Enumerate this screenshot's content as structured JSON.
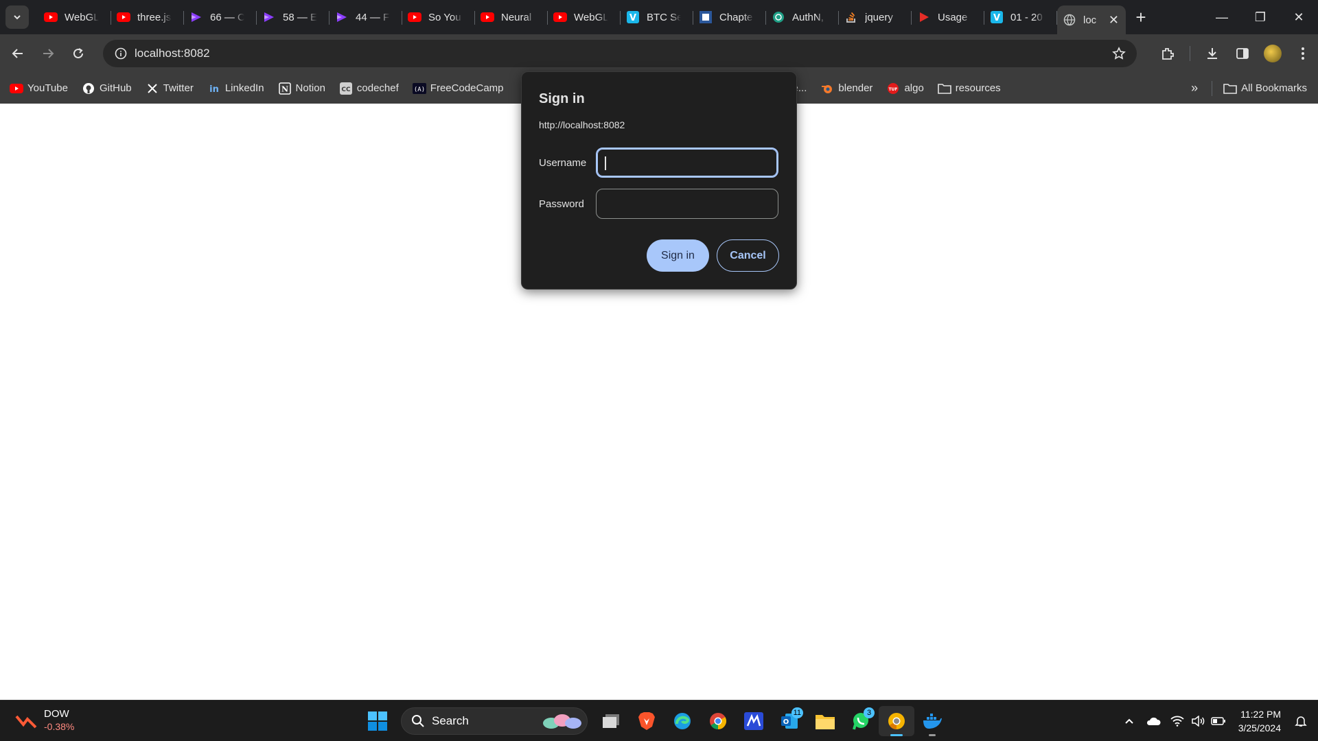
{
  "tabs": [
    {
      "title": "WebGL",
      "icon": "youtube-icon"
    },
    {
      "title": "three.js",
      "icon": "youtube-icon"
    },
    {
      "title": "66 — C",
      "icon": "course-icon"
    },
    {
      "title": "58 — E",
      "icon": "course-icon"
    },
    {
      "title": "44 — F",
      "icon": "course-icon"
    },
    {
      "title": "So You",
      "icon": "youtube-icon"
    },
    {
      "title": "Neural",
      "icon": "youtube-icon"
    },
    {
      "title": "WebGL",
      "icon": "youtube-icon"
    },
    {
      "title": "BTC Se",
      "icon": "vimeo-icon"
    },
    {
      "title": "Chapte",
      "icon": "document-icon"
    },
    {
      "title": "AuthN,",
      "icon": "openai-icon"
    },
    {
      "title": "jquery",
      "icon": "stackoverflow-icon"
    },
    {
      "title": "Usage",
      "icon": "play-icon"
    },
    {
      "title": "01 - 20",
      "icon": "vimeo-icon"
    }
  ],
  "active_tab": {
    "title": "loc",
    "icon": "globe-icon"
  },
  "address_bar": {
    "url": "localhost:8082"
  },
  "bookmarks": [
    {
      "label": "YouTube",
      "icon": "youtube-icon"
    },
    {
      "label": "GitHub",
      "icon": "github-icon"
    },
    {
      "label": "Twitter",
      "icon": "x-icon"
    },
    {
      "label": "LinkedIn",
      "icon": "linkedin-icon"
    },
    {
      "label": "Notion",
      "icon": "notion-icon"
    },
    {
      "label": "codechef",
      "icon": "codechef-icon"
    },
    {
      "label": "FreeCodeCamp",
      "icon": "freecodecamp-icon"
    }
  ],
  "bookmarks_right": [
    {
      "label": "y Acade...",
      "icon": ""
    },
    {
      "label": "blender",
      "icon": "blender-icon"
    },
    {
      "label": "algo",
      "icon": "algo-icon"
    },
    {
      "label": "resources",
      "icon": "folder-icon"
    }
  ],
  "all_bookmarks_label": "All Bookmarks",
  "dialog": {
    "title": "Sign in",
    "origin": "http://localhost:8082",
    "username_label": "Username",
    "password_label": "Password",
    "username_value": "",
    "password_value": "",
    "signin_label": "Sign in",
    "cancel_label": "Cancel"
  },
  "taskbar": {
    "widget_name": "DOW",
    "widget_value": "-0.38%",
    "search_label": "Search",
    "apps": [
      {
        "name": "task-view",
        "badge": ""
      },
      {
        "name": "brave",
        "badge": ""
      },
      {
        "name": "edge",
        "badge": ""
      },
      {
        "name": "chrome",
        "badge": ""
      },
      {
        "name": "app-m",
        "badge": ""
      },
      {
        "name": "outlook",
        "badge": "11"
      },
      {
        "name": "file-explorer",
        "badge": ""
      },
      {
        "name": "whatsapp",
        "badge": "3"
      },
      {
        "name": "chrome-canary",
        "badge": ""
      },
      {
        "name": "docker",
        "badge": ""
      }
    ],
    "time": "11:22 PM",
    "date": "3/25/2024"
  }
}
